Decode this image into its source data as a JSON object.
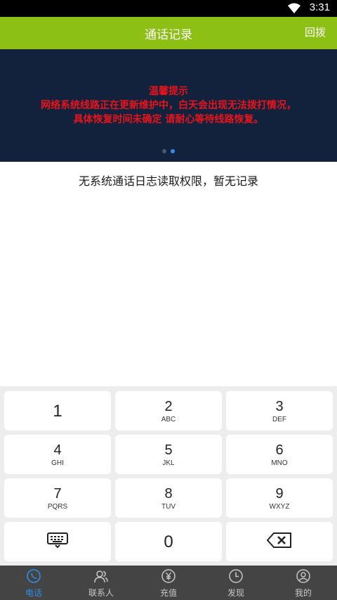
{
  "status_bar": {
    "time": "3:31",
    "wifi_icon": "wifi-icon"
  },
  "app_bar": {
    "title": "通话记录",
    "action_label": "回拨",
    "color": "#8cc014"
  },
  "banner": {
    "background": "#12213c",
    "text_color": "#e8141c",
    "notice_title": "温馨提示",
    "notice_line1": "网络系统线路正在更新维护中，白天会出现无法拨打情况，",
    "notice_line2": "具体恢复时间未确定 请耐心等待线路恢复。",
    "page_count": 2,
    "active_page": 2
  },
  "empty_message": "无系统通话日志读取权限，暂无记录",
  "keypad": {
    "keys": [
      {
        "digit": "1",
        "letters": ""
      },
      {
        "digit": "2",
        "letters": "ABC"
      },
      {
        "digit": "3",
        "letters": "DEF"
      },
      {
        "digit": "4",
        "letters": "GHI"
      },
      {
        "digit": "5",
        "letters": "JKL"
      },
      {
        "digit": "6",
        "letters": "MNO"
      },
      {
        "digit": "7",
        "letters": "PQRS"
      },
      {
        "digit": "8",
        "letters": "TUV"
      },
      {
        "digit": "9",
        "letters": "WXYZ"
      }
    ],
    "zero": "0",
    "left_key_icon": "keyboard-icon",
    "right_key_icon": "backspace-icon"
  },
  "bottom_nav": {
    "items": [
      {
        "label": "电话",
        "icon": "phone-icon",
        "active": true
      },
      {
        "label": "联系人",
        "icon": "contacts-icon",
        "active": false
      },
      {
        "label": "充值",
        "icon": "yen-icon",
        "active": false
      },
      {
        "label": "发现",
        "icon": "clock-icon",
        "active": false
      },
      {
        "label": "我的",
        "icon": "user-icon",
        "active": false
      }
    ],
    "active_color": "#2f8ee8"
  }
}
